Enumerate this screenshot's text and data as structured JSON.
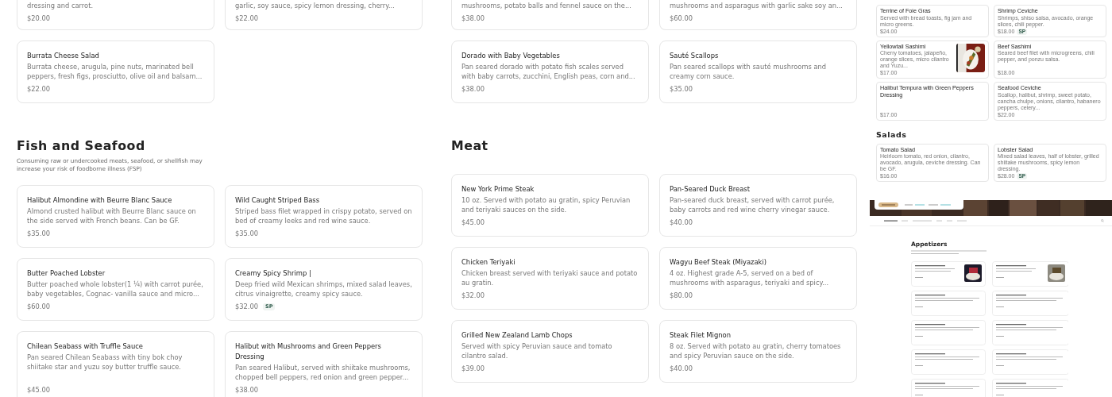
{
  "columns": [
    {
      "kind": "main",
      "sections": [
        {
          "items": [
            {
              "cut": true,
              "description": "dressing and carrot.",
              "price": "$20.00"
            },
            {
              "cut": true,
              "description": "garlic, soy sauce, spicy lemon dressing, cherry...",
              "price": "$22.00"
            },
            {
              "name": "Burrata Cheese Salad",
              "description": "Burrata cheese, arugula, pine nuts, marinated bell peppers, fresh figs, prosciutto, olive oil and balsam...",
              "price": "$22.00"
            }
          ]
        },
        {
          "title": "Fish and Seafood",
          "note": "Consuming raw or undercooked meats, seafood, or shellfish may increase your risk of foodborne illness (FSP)",
          "items": [
            {
              "name": "Halibut Almondine with Beurre Blanc Sauce",
              "description": "Almond crusted halibut with Beurre Blanc sauce on the side served with French beans. Can be GF.",
              "price": "$35.00"
            },
            {
              "name": "Wild Caught Striped Bass",
              "description": "Striped bass filet wrapped in crispy potato, served on bed of creamy leeks and red wine sauce.",
              "price": "$35.00"
            },
            {
              "name": "Butter Poached Lobster",
              "description": "Butter poached whole lobster(1 ¼) with carrot purée, baby vegetables, Cognac- vanilla sauce and micro...",
              "price": "$60.00"
            },
            {
              "name": "Creamy Spicy Shrimp |",
              "description": "Deep fried wild Mexican shrimps, mixed salad leaves, citrus vinaigrette, creamy spicy sauce.",
              "price": "$32.00",
              "tag": "SP"
            },
            {
              "name": "Chilean Seabass with Truffle Sauce",
              "description": "Pan seared Chilean Seabass with tiny bok choy shiitake star and yuzu soy butter truffle sauce.",
              "price": "$45.00"
            },
            {
              "name": "Halibut with Mushrooms and Green Peppers Dressing",
              "description": "Pan seared Halibut, served with shiitake mushrooms, chopped bell peppers, red onion and green pepper...",
              "price": "$38.00"
            }
          ]
        }
      ]
    },
    {
      "kind": "main",
      "sections": [
        {
          "items": [
            {
              "cut": true,
              "description": "mushrooms, potato balls and fennel sauce on the...",
              "price": "$38.00"
            },
            {
              "cut": true,
              "description": "mushrooms and asparagus with garlic sake soy an...",
              "price": "$60.00"
            },
            {
              "name": "Dorado with Baby Vegetables",
              "description": "Pan seared dorado with potato fish scales served with baby carrots, zucchini, English peas, corn and...",
              "price": "$38.00"
            },
            {
              "name": "Sauté Scallops",
              "description": "Pan seared scallops with sauté mushrooms and creamy corn sauce.",
              "price": "$35.00"
            }
          ]
        },
        {
          "title": "Meat",
          "items": [
            {
              "name": "New York Prime Steak",
              "description": "10 oz. Served with potato au gratin, spicy Peruvian and teriyaki sauces on the side.",
              "price": "$45.00"
            },
            {
              "name": "Pan-Seared Duck Breast",
              "description": "Pan-seared duck breast, served with carrot purée, baby carrots and red wine cherry vinegar sauce.",
              "price": "$40.00"
            },
            {
              "name": "Chicken Teriyaki",
              "description": "Chicken breast served with teriyaki sauce and potato au gratin.",
              "price": "$32.00"
            },
            {
              "name": "Wagyu Beef Steak (Miyazaki)",
              "description": "4 oz. Highest grade A-5, served on a bed of mushrooms with asparagus, teriyaki and spicy...",
              "price": "$80.00"
            },
            {
              "name": "Grilled New Zealand Lamb Chops",
              "description": "Served with spicy Peruvian sauce and tomato cilantro salad.",
              "price": "$39.00"
            },
            {
              "name": "Steak Filet Mignon",
              "description": "8 oz. Served with potato au gratin, cherry tomatoes and spicy Peruvian sauce on the side.",
              "price": "$40.00"
            }
          ]
        }
      ]
    },
    {
      "kind": "preview",
      "sections": [
        {
          "items": [
            {
              "name": "Terrine of Foie Gras",
              "description": "Served with bread toasts, fig jam and micro greens.",
              "price": "$24.00"
            },
            {
              "name": "Shrimp Ceviche",
              "description": "Shrimps, shiso salsa, avocado, orange slices, chili pepper.",
              "price": "$18.00",
              "tag": "SP"
            },
            {
              "name": "Yellowtail Sashimi",
              "description": "Cherry tomatoes, jalapeño, orange slices, micro cilantro and Yuzu...",
              "price": "$17.00"
            },
            {
              "name": "Beef Sashimi",
              "description": "Seared beef filet with microgreens, chili pepper, and ponzu salsa.",
              "price": "$18.00"
            },
            {
              "name": "Halibut Tempura with Green Peppers Dressing",
              "price": "$17.00"
            },
            {
              "name": "Seafood Ceviche",
              "description": "Scallop, halibut, shrimp, sweet potato, cancha chulpe, onions, cilantro, habanero peppers, celery...",
              "price": "$22.00"
            }
          ]
        },
        {
          "title": "Salads",
          "items": [
            {
              "name": "Tomato Salad",
              "description": "Heirloom tomato, red onion, cilantro, avocado, arugula, ceviche dressing. Can be GF.",
              "price": "$16.00"
            },
            {
              "name": "Lobster Salad",
              "description": "Mixed salad leaves, half of lobster, grilled shiitake mushrooms, spicy lemon dressing.",
              "price": "$28.00",
              "tag": "SP"
            }
          ]
        }
      ],
      "page": {
        "title": "Appetizers"
      }
    }
  ]
}
